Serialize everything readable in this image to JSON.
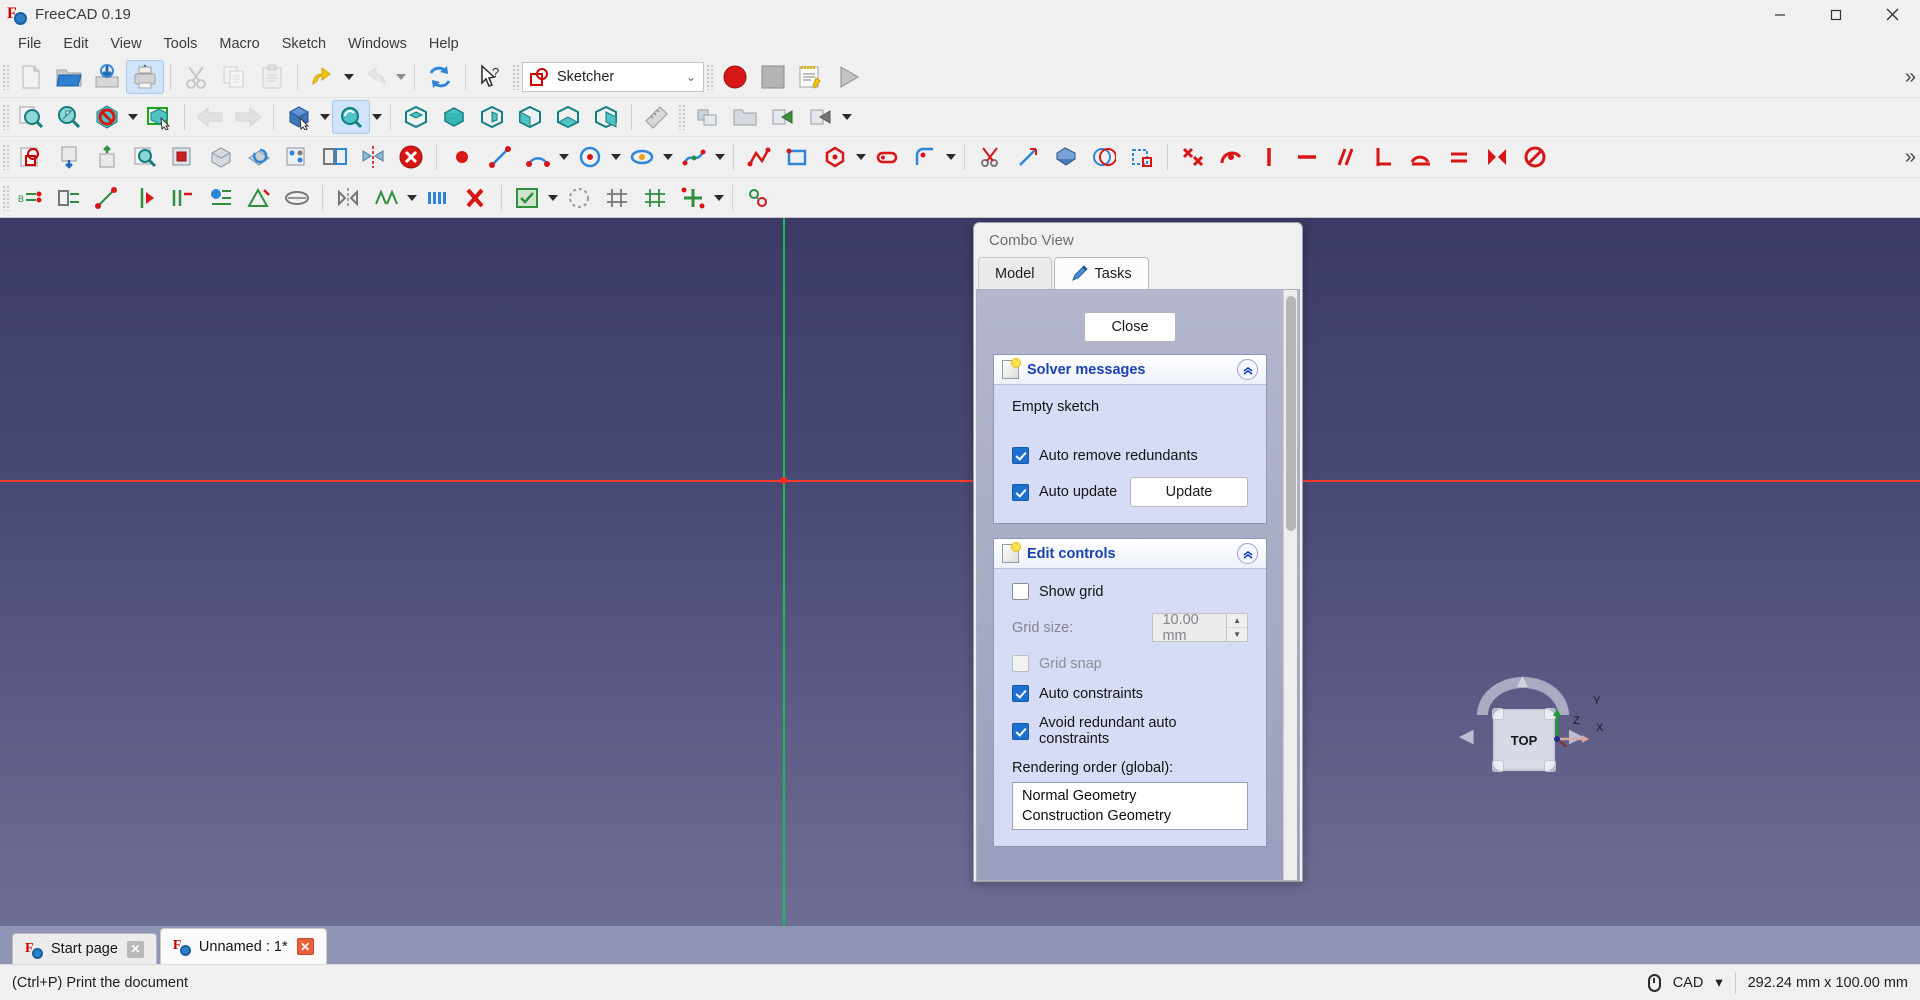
{
  "window": {
    "title": "FreeCAD 0.19",
    "logo_icon": "freecad-logo-icon",
    "minimize_label": "—",
    "maximize_label": "❐",
    "close_label": "✕"
  },
  "menubar": {
    "items": [
      {
        "label": "File"
      },
      {
        "label": "Edit"
      },
      {
        "label": "View"
      },
      {
        "label": "Tools"
      },
      {
        "label": "Macro"
      },
      {
        "label": "Sketch"
      },
      {
        "label": "Windows"
      },
      {
        "label": "Help"
      }
    ]
  },
  "toolbars": {
    "file": [
      {
        "name": "new-document-button",
        "icon": "new-document-icon"
      },
      {
        "name": "open-document-button",
        "icon": "open-folder-icon"
      },
      {
        "name": "save-document-button",
        "icon": "save-disk-icon"
      },
      {
        "name": "print-document-button",
        "icon": "printer-icon",
        "active": true
      },
      {
        "name": "cut-button",
        "icon": "scissors-icon",
        "disabled": true
      },
      {
        "name": "copy-button",
        "icon": "copy-pages-icon",
        "disabled": true
      },
      {
        "name": "paste-button",
        "icon": "clipboard-icon",
        "disabled": true
      },
      {
        "name": "undo-button",
        "icon": "undo-arrow-icon"
      },
      {
        "name": "redo-button",
        "icon": "redo-arrow-icon",
        "disabled": true
      },
      {
        "name": "refresh-button",
        "icon": "refresh-icon"
      },
      {
        "name": "whats-this-button",
        "icon": "cursor-question-icon"
      }
    ],
    "workbench": {
      "name": "workbench-selector",
      "value": "Sketcher",
      "icon": "sketcher-workbench-icon",
      "chevron": "⌄"
    },
    "macro": [
      {
        "name": "macro-record-button",
        "icon": "record-circle-icon"
      },
      {
        "name": "macro-stop-button",
        "icon": "stop-square-icon"
      },
      {
        "name": "macro-edit-button",
        "icon": "notepad-pencil-icon"
      },
      {
        "name": "macro-execute-button",
        "icon": "play-triangle-icon"
      }
    ],
    "view": [
      {
        "name": "fit-all-button",
        "icon": "fit-all-icon"
      },
      {
        "name": "fit-selection-button",
        "icon": "fit-selection-icon"
      },
      {
        "name": "draw-style-button",
        "icon": "draw-style-icon",
        "dropdown": true
      },
      {
        "name": "box-selection-button",
        "icon": "box-selection-icon"
      },
      {
        "name": "view-back-button",
        "icon": "left-arrow-icon",
        "disabled": true
      },
      {
        "name": "view-forward-button",
        "icon": "right-arrow-icon",
        "disabled": true
      },
      {
        "name": "isometric-view-button",
        "icon": "iso-cube-icon",
        "dropdown": true
      },
      {
        "name": "axonometric-view-button",
        "icon": "axonometric-cube-icon",
        "dropdown": true,
        "active": true
      },
      {
        "name": "front-view-button",
        "icon": "front-cube-icon"
      },
      {
        "name": "top-view-button",
        "icon": "top-cube-icon"
      },
      {
        "name": "right-view-button",
        "icon": "right-cube-icon"
      },
      {
        "name": "rear-view-button",
        "icon": "rear-cube-icon"
      },
      {
        "name": "bottom-view-button",
        "icon": "bottom-cube-icon"
      },
      {
        "name": "left-view-button",
        "icon": "left-cube-icon"
      },
      {
        "name": "measure-button",
        "icon": "ruler-icon"
      },
      {
        "name": "workbench-link-button",
        "icon": "link-icon"
      },
      {
        "name": "group-button",
        "icon": "folder-icon"
      },
      {
        "name": "make-link-button",
        "icon": "make-link-icon"
      },
      {
        "name": "link-actions-button",
        "icon": "link-actions-icon",
        "dropdown": true
      }
    ],
    "sketcher_edit": [
      {
        "name": "create-sketch-button",
        "icon": "create-sketch-icon"
      },
      {
        "name": "edit-sketch-button",
        "icon": "edit-sketch-icon"
      },
      {
        "name": "leave-sketch-button",
        "icon": "leave-sketch-icon"
      },
      {
        "name": "view-sketch-button",
        "icon": "view-sketch-icon"
      },
      {
        "name": "view-section-button",
        "icon": "view-section-icon"
      },
      {
        "name": "map-sketch-button",
        "icon": "map-sketch-icon"
      },
      {
        "name": "reorient-sketch-button",
        "icon": "reorient-sketch-icon"
      },
      {
        "name": "validate-sketch-button",
        "icon": "validate-sketch-icon"
      },
      {
        "name": "merge-sketches-button",
        "icon": "merge-sketches-icon"
      },
      {
        "name": "mirror-sketch-button",
        "icon": "mirror-sketch-icon"
      },
      {
        "name": "stop-edit-button",
        "icon": "red-x-circle-icon"
      }
    ],
    "sketcher_geometry": [
      {
        "name": "create-point-button",
        "icon": "point-icon"
      },
      {
        "name": "create-line-button",
        "icon": "line-icon"
      },
      {
        "name": "create-arc-button",
        "icon": "arc-icon",
        "dropdown": true
      },
      {
        "name": "create-circle-button",
        "icon": "circle-icon",
        "dropdown": true
      },
      {
        "name": "create-conic-button",
        "icon": "ellipse-icon",
        "dropdown": true
      },
      {
        "name": "create-bspline-button",
        "icon": "bspline-icon",
        "dropdown": true
      },
      {
        "name": "create-polyline-button",
        "icon": "polyline-icon"
      },
      {
        "name": "create-rectangle-button",
        "icon": "rectangle-icon"
      },
      {
        "name": "create-regular-polygon-button",
        "icon": "polygon-icon",
        "dropdown": true
      },
      {
        "name": "create-slot-button",
        "icon": "slot-icon"
      },
      {
        "name": "create-fillet-button",
        "icon": "fillet-icon",
        "dropdown": true
      },
      {
        "name": "trim-edge-button",
        "icon": "trim-icon"
      },
      {
        "name": "extend-edge-button",
        "icon": "extend-icon"
      },
      {
        "name": "external-geometry-button",
        "icon": "external-geometry-icon"
      },
      {
        "name": "carbon-copy-button",
        "icon": "carbon-copy-icon"
      },
      {
        "name": "toggle-construction-button",
        "icon": "toggle-construction-icon"
      }
    ],
    "sketcher_constraints": [
      {
        "name": "constrain-coincident-button",
        "icon": "coincident-icon"
      },
      {
        "name": "constrain-point-on-object-button",
        "icon": "point-on-object-icon"
      },
      {
        "name": "constrain-vertical-button",
        "icon": "vertical-icon"
      },
      {
        "name": "constrain-horizontal-button",
        "icon": "horizontal-icon"
      },
      {
        "name": "constrain-parallel-button",
        "icon": "parallel-icon"
      },
      {
        "name": "constrain-perpendicular-button",
        "icon": "perpendicular-icon"
      },
      {
        "name": "constrain-tangent-button",
        "icon": "tangent-icon"
      },
      {
        "name": "constrain-equal-button",
        "icon": "equal-icon"
      },
      {
        "name": "constrain-symmetric-button",
        "icon": "symmetric-icon"
      },
      {
        "name": "constrain-block-button",
        "icon": "block-icon"
      }
    ],
    "sketcher_visual": [
      {
        "name": "select-elements-associated-button",
        "icon": "select-associated-icon"
      },
      {
        "name": "select-constraints-button",
        "icon": "select-constraints-icon"
      },
      {
        "name": "select-origin-button",
        "icon": "select-origin-icon"
      },
      {
        "name": "select-vertical-axis-button",
        "icon": "select-vertical-axis-icon"
      },
      {
        "name": "select-horizontal-axis-button",
        "icon": "select-horizontal-axis-icon"
      },
      {
        "name": "select-redundant-button",
        "icon": "select-redundant-icon"
      },
      {
        "name": "select-conflicting-button",
        "icon": "select-conflicting-icon"
      },
      {
        "name": "restore-internal-geometry-button",
        "icon": "restore-internal-icon"
      },
      {
        "name": "symmetry-button",
        "icon": "symmetry-tool-icon"
      },
      {
        "name": "clone-button",
        "icon": "clone-icon",
        "dropdown": true
      },
      {
        "name": "rectangular-array-button",
        "icon": "rect-array-icon"
      },
      {
        "name": "delete-all-constraints-button",
        "icon": "delete-constraints-icon"
      },
      {
        "name": "switch-virtual-space-button",
        "icon": "virtual-space-icon",
        "dropdown": true
      },
      {
        "name": "sketcher-visual-button",
        "icon": "visual-sketch-icon"
      },
      {
        "name": "sketcher-grid-button",
        "icon": "grid-icon"
      },
      {
        "name": "sketcher-snap-button",
        "icon": "snap-icon"
      },
      {
        "name": "sketcher-render-button",
        "icon": "render-order-icon",
        "dropdown": true
      },
      {
        "name": "sketcher-virtual-button",
        "icon": "virtual-icon"
      }
    ],
    "overflow_label": "»"
  },
  "viewport": {
    "navcube": {
      "face_label": "TOP",
      "axis_x": "X",
      "axis_y": "Y",
      "axis_z": "Z",
      "arrow_up": "▲",
      "arrow_left": "◀",
      "arrow_right": "▶"
    },
    "origin_color": "#ff2a1f",
    "x_axis_color": "#ff3b30",
    "y_axis_color": "#1db954"
  },
  "combo_view": {
    "title": "Combo View",
    "tabs": [
      {
        "label": "Model",
        "selected": false,
        "icon": null
      },
      {
        "label": "Tasks",
        "selected": true,
        "icon": "pencil-icon"
      }
    ],
    "close_button": "Close",
    "solver": {
      "title": "Solver messages",
      "collapse_icon": "chevron-up-icon",
      "message": "Empty sketch",
      "auto_remove_redundants": {
        "label": "Auto remove redundants",
        "checked": true
      },
      "auto_update": {
        "label": "Auto update",
        "checked": true
      },
      "update_button": "Update"
    },
    "edit_controls": {
      "title": "Edit controls",
      "collapse_icon": "chevron-up-icon",
      "show_grid": {
        "label": "Show grid",
        "checked": false
      },
      "grid_size": {
        "label": "Grid size:",
        "value": "10.00 mm",
        "disabled": true
      },
      "grid_snap": {
        "label": "Grid snap",
        "checked": false,
        "disabled": true
      },
      "auto_constraints": {
        "label": "Auto constraints",
        "checked": true
      },
      "avoid_redundant": {
        "label": "Avoid redundant auto constraints",
        "checked": true
      },
      "rendering_order_label": "Rendering order (global):",
      "rendering_order_items": [
        "Normal Geometry",
        "Construction Geometry"
      ]
    }
  },
  "document_tabs": [
    {
      "label": "Start page",
      "active": false,
      "close_icon": "close-icon"
    },
    {
      "label": "Unnamed : 1*",
      "active": true,
      "close_icon": "close-icon"
    }
  ],
  "statusbar": {
    "message": "(Ctrl+P) Print the document",
    "navigation_icon": "mouse-icon",
    "navigation_mode": "CAD",
    "navigation_chevron": "▾",
    "dimensions": "292.24 mm x 100.00 mm"
  }
}
